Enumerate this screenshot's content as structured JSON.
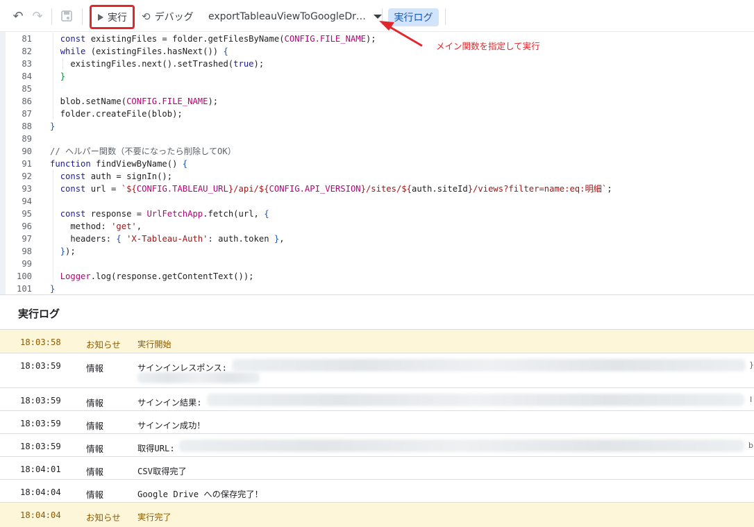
{
  "toolbar": {
    "run_label": "実行",
    "debug_label": "デバッグ",
    "function_name": "exportTableauViewToGoogleDr…",
    "log_button_label": "実行ログ"
  },
  "annotation": {
    "text": "メイン関数を指定して実行",
    "color": "#e3262b"
  },
  "editor": {
    "line_numbers": [
      "81",
      "82",
      "83",
      "84",
      "85",
      "86",
      "87",
      "88",
      "89",
      "90",
      "91",
      "92",
      "93",
      "94",
      "95",
      "96",
      "97",
      "98",
      "99",
      "100",
      "101"
    ]
  },
  "log": {
    "title": "実行ログ",
    "rows": [
      {
        "time": "18:03:58",
        "level": "お知らせ",
        "message": "実行開始"
      },
      {
        "time": "18:03:59",
        "level": "情報",
        "message": "サインインレスポンス:"
      },
      {
        "time": "18:03:59",
        "level": "情報",
        "message": "サインイン結果:"
      },
      {
        "time": "18:03:59",
        "level": "情報",
        "message": "サインイン成功！"
      },
      {
        "time": "18:03:59",
        "level": "情報",
        "message": "取得URL:"
      },
      {
        "time": "18:04:01",
        "level": "情報",
        "message": "CSV取得完了"
      },
      {
        "time": "18:04:04",
        "level": "情報",
        "message": "Google Drive への保存完了！"
      },
      {
        "time": "18:04:04",
        "level": "お知らせ",
        "message": "実行完了"
      }
    ],
    "row2_tail_glyph": "}",
    "row3_tail_glyph": "I",
    "row5_tail_glyph": "b"
  },
  "icons": {
    "undo": "undo-icon",
    "redo": "redo-icon",
    "save": "save-icon",
    "play": "play-icon",
    "debug": "debug-icon",
    "dropdown": "chevron-down-icon"
  }
}
